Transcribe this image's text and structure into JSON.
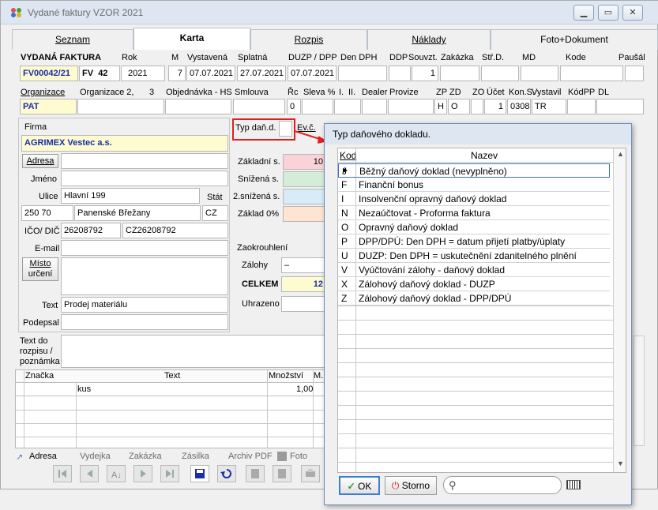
{
  "window": {
    "title": "Vydané faktury VZOR  2021"
  },
  "tabs": [
    "Seznam",
    "Karta",
    "Rozpis",
    "Náklady",
    "Foto+Dokument"
  ],
  "header_labels": {
    "vydana": "VYDANÁ FAKTURA",
    "rok": "Rok",
    "m": "M",
    "vystavena": "Vystavená",
    "splatna": "Splatná",
    "duzp": "DUZP / DPP",
    "den_dph": "Den DPH",
    "ddp": "DDP",
    "souvzt": "Souvzt.",
    "zakazka": "Zakázka",
    "strd": "Stř.D.",
    "md": "MD",
    "kode": "Kode",
    "pausal": "Paušál"
  },
  "header_values": {
    "cislo": "FV00042/21",
    "rada": "FV",
    "rada_num": "42",
    "rok": "2021",
    "m": "7",
    "vystavena": "07.07.2021",
    "splatna": "27.07.2021",
    "duzp": "07.07.2021",
    "souvzt": "1"
  },
  "row2_labels": {
    "organizace": "Organizace",
    "organizace2": "Organizace 2,",
    "n3": "3",
    "objednavka": "Objednávka - HS",
    "smlouva": "Smlouva",
    "rc": "Řc",
    "sleva": "Sleva %",
    "i": "I.",
    "ii": "II.",
    "dealer": "Dealer",
    "provize": "Provize",
    "zp": "ZP",
    "zd": "ZD",
    "zo": "ZO",
    "ucet": "Účet",
    "kons": "Kon.S.",
    "vystavil": "Vystavil",
    "kodpp": "KódPP",
    "dl": "DL"
  },
  "row2_values": {
    "organizace": "PAT",
    "rc": "0",
    "zp": "H",
    "zd": "O",
    "ucet": "1",
    "kons": "0308",
    "vystavil": "TR"
  },
  "firma": {
    "label": "Firma",
    "name": "AGRIMEX Vestec a.s.",
    "adresa_btn": "Adresa",
    "jmeno_label": "Jméno",
    "ulice_label": "Ulice",
    "ulice": "Hlavní 199",
    "stat_label": "Stát",
    "psc": "250 70",
    "mesto": "Panenské Břežany",
    "stat": "CZ",
    "ico_label": "IČO/ DIČ",
    "ico": "26208792",
    "dic": "CZ26208792",
    "email_label": "E-mail",
    "misto_btn_1": "Místo",
    "misto_btn_2": "určení",
    "text_label": "Text",
    "text": "Prodej materiálu",
    "podepsal_label": "Podepsal"
  },
  "dph": {
    "typ_label": "Typ daň.d.",
    "ev_label": "Ev.č.",
    "zakladni": "Základní s.",
    "snizena": "Snížená s.",
    "snizena2": "2.snížená s.",
    "zaklad0": "Základ 0%",
    "zakl_val": "10",
    "zaokrouhleni": "Zaokrouhlení",
    "zalohy": "Zálohy",
    "zalohy_dash": "–",
    "celkem": "CELKEM",
    "celkem_val": "12",
    "uhrazeno": "Uhrazeno"
  },
  "text_do": {
    "label": "Text do rozpisu / poznámka"
  },
  "items": {
    "headers": [
      "Značka",
      "Text",
      "Množství",
      "M..."
    ],
    "rows": [
      {
        "znacka": "",
        "text": "kus",
        "mnozstvi": "1,00"
      }
    ]
  },
  "bottom_links": [
    "Adresa",
    "Vydejka",
    "Zakázka",
    "Zásilka",
    "Archiv PDF",
    "Foto"
  ],
  "dialog": {
    "title": "Typ daňového dokladu.",
    "col_kod": "Kod",
    "col_nazev": "Nazev",
    "rows": [
      {
        "k": "J",
        "n": "Běžný daňový doklad (nevyplněno)"
      },
      {
        "k": "F",
        "n": "Finanční bonus"
      },
      {
        "k": "I",
        "n": "Insolvenční opravný daňový doklad"
      },
      {
        "k": "N",
        "n": "Nezaúčtovat - Proforma faktura"
      },
      {
        "k": "O",
        "n": "Opravný daňový doklad"
      },
      {
        "k": "P",
        "n": "DPP/DPÚ: Den DPH = datum přijetí platby/úplaty"
      },
      {
        "k": "U",
        "n": "DUZP: Den DPH = uskutečnění zdanitelného plnění"
      },
      {
        "k": "V",
        "n": "Vyúčtování zálohy - daňový doklad"
      },
      {
        "k": "X",
        "n": "Zálohový daňový doklad - DUZP"
      },
      {
        "k": "Z",
        "n": "Zálohový daňový doklad - DPP/DPÚ"
      }
    ],
    "ok": "OK",
    "storno": "Storno",
    "search_placeholder": ""
  },
  "colors": {
    "accent_blue": "#1a2ea8",
    "highlight_red": "#e02020",
    "zakl_pink": "#f9d3d8",
    "sniz_green": "#d4edd8",
    "sniz2_blue": "#d7ecf7",
    "zakl0_peach": "#fde5d2"
  }
}
